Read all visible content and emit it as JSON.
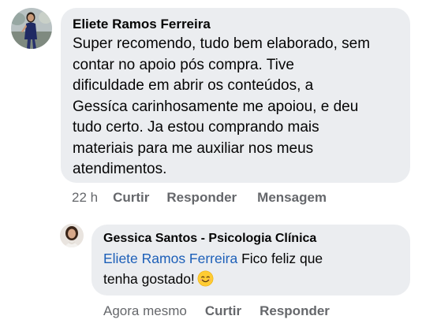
{
  "comments": [
    {
      "author": "Eliete Ramos Ferreira",
      "text": "Super recomendo, tudo bem elaborado, sem\ncontar no apoio pós compra. Tive\ndificuldade em abrir os conteúdos, a\nGessíca carinhosamente me apoiou, e deu\ntudo certo. Ja estou comprando mais\nmateriais para me auxiliar nos meus\natendimentos.",
      "timestamp": "22 h",
      "actions": {
        "like": "Curtir",
        "reply": "Responder",
        "message": "Mensagem"
      }
    }
  ],
  "reply": {
    "author": "Gessica Santos - Psicologia Clínica",
    "mention": "Eliete Ramos Ferreira",
    "text": " Fico feliz que\ntenha gostado!",
    "emoji": "smiling-face-emoji",
    "timestamp": "Agora mesmo",
    "actions": {
      "like": "Curtir",
      "reply": "Responder"
    }
  },
  "colors": {
    "bubble": "#ebedf0",
    "text": "#050505",
    "mention": "#1c5fb8",
    "meta": "#65676b"
  }
}
